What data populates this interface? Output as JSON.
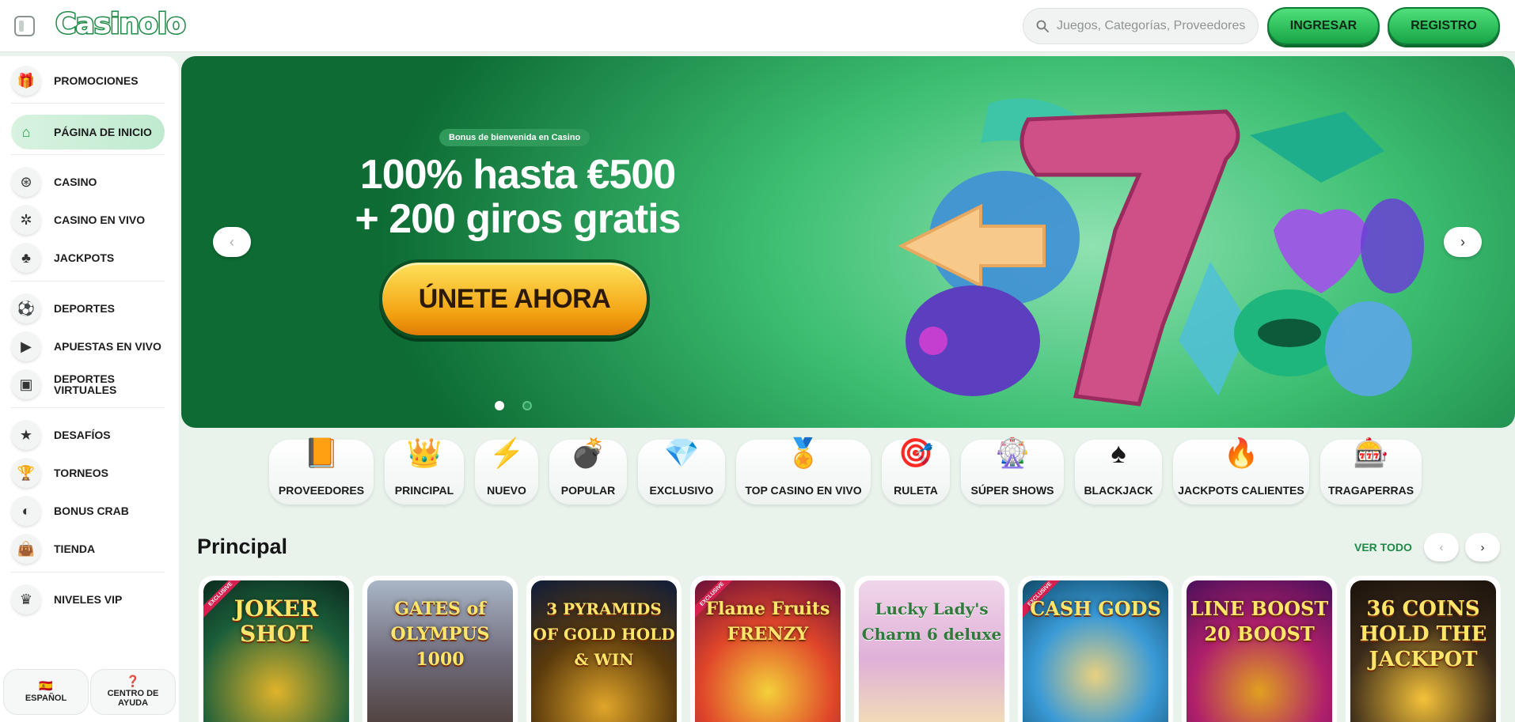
{
  "header": {
    "logo": "Casinolo",
    "search_placeholder": "Juegos, Categorías, Proveedores",
    "login_label": "INGRESAR",
    "register_label": "REGISTRO"
  },
  "sidebar": {
    "items": [
      {
        "label": "PROMOCIONES",
        "icon": "gift-icon"
      },
      {
        "label": "PÁGINA DE INICIO",
        "icon": "home-icon",
        "active": true
      },
      {
        "label": "CASINO",
        "icon": "casino-chip-icon"
      },
      {
        "label": "CASINO EN VIVO",
        "icon": "live-casino-icon"
      },
      {
        "label": "JACKPOTS",
        "icon": "club-icon"
      },
      {
        "label": "DEPORTES",
        "icon": "soccer-ball-icon"
      },
      {
        "label": "APUESTAS EN VIVO",
        "icon": "live-bet-icon"
      },
      {
        "label": "DEPORTES VIRTUALES",
        "icon": "virtual-sports-icon"
      },
      {
        "label": "DESAFÍOS",
        "icon": "star-icon"
      },
      {
        "label": "TORNEOS",
        "icon": "trophy-icon"
      },
      {
        "label": "BONUS CRAB",
        "icon": "crab-icon"
      },
      {
        "label": "TIENDA",
        "icon": "shopping-bag-icon"
      },
      {
        "label": "NIVELES VIP",
        "icon": "crown-icon"
      }
    ],
    "language_label": "ESPAÑOL",
    "help_label": "CENTRO DE AYUDA"
  },
  "banner": {
    "tag": "Bonus de bienvenida en Casino",
    "title_line1": "100% hasta €500",
    "title_line2": "+ 200 giros gratis",
    "cta_label": "ÚNETE AHORA",
    "active_slide": 1,
    "slide_count": 2
  },
  "categories": [
    {
      "label": "PROVEEDORES",
      "icon": "book-icon"
    },
    {
      "label": "PRINCIPAL",
      "icon": "crown-icon"
    },
    {
      "label": "NUEVO",
      "icon": "lightning-icon"
    },
    {
      "label": "POPULAR",
      "icon": "bomb-icon"
    },
    {
      "label": "EXCLUSIVO",
      "icon": "diamond-icon"
    },
    {
      "label": "TOP CASINO EN VIVO",
      "icon": "medal-icon"
    },
    {
      "label": "RULETA",
      "icon": "roulette-icon"
    },
    {
      "label": "SÚPER SHOWS",
      "icon": "wheel-icon"
    },
    {
      "label": "BLACKJACK",
      "icon": "spade-icon"
    },
    {
      "label": "JACKPOTS CALIENTES",
      "icon": "fire-icon"
    },
    {
      "label": "TRAGAPERRAS",
      "icon": "slot-machine-icon"
    }
  ],
  "section": {
    "title": "Principal",
    "see_all": "VER TODO"
  },
  "games": [
    {
      "name": "JOKER SHOT",
      "exclusive": true
    },
    {
      "name": "GATES of OLYMPUS 1000",
      "exclusive": false
    },
    {
      "name": "3 PYRAMIDS OF GOLD HOLD & WIN",
      "exclusive": false
    },
    {
      "name": "Flame Fruits FRENZY",
      "exclusive": true
    },
    {
      "name": "Lucky Lady's Charm 6 deluxe",
      "exclusive": false
    },
    {
      "name": "CASH GODS",
      "exclusive": true
    },
    {
      "name": "LINE BOOST 20 BOOST",
      "exclusive": false
    },
    {
      "name": "36 COINS HOLD THE JACKPOT",
      "exclusive": false
    }
  ],
  "colors": {
    "brand_green": "#1f8b47",
    "page_bg": "#e9f3ec",
    "cta_orange": "#f3a312"
  }
}
